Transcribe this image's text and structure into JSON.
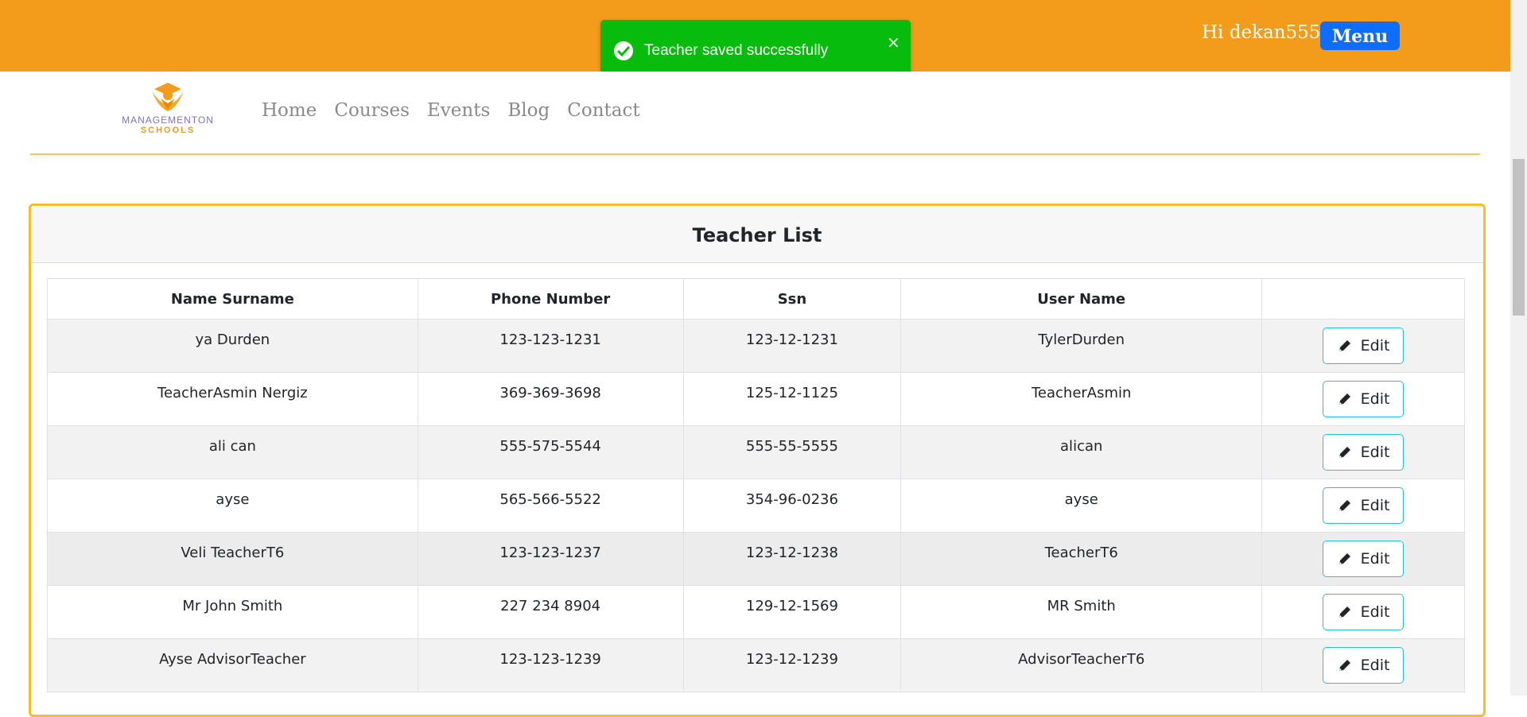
{
  "header": {
    "greeting": "Hi dekan555",
    "menu_label": "Menu"
  },
  "toast": {
    "message": "Teacher saved successfully",
    "close_glyph": "×",
    "color": "#07bc0c"
  },
  "brand": {
    "name_line1": "MANAGEMENTON",
    "name_line2": "SCHOOLS"
  },
  "nav": {
    "items": [
      "Home",
      "Courses",
      "Events",
      "Blog",
      "Contact"
    ]
  },
  "card": {
    "title": "Teacher List"
  },
  "table": {
    "headers": [
      "Name Surname",
      "Phone Number",
      "Ssn",
      "User Name",
      ""
    ],
    "edit_label": "Edit",
    "rows": [
      [
        "ya Durden",
        "123-123-1231",
        "123-12-1231",
        "TylerDurden"
      ],
      [
        "TeacherAsmin Nergiz",
        "369-369-3698",
        "125-12-1125",
        "TeacherAsmin"
      ],
      [
        "ali can",
        "555-575-5544",
        "555-55-5555",
        "alican"
      ],
      [
        "ayse",
        "565-566-5522",
        "354-96-0236",
        "ayse"
      ],
      [
        "Veli TeacherT6",
        "123-123-1237",
        "123-12-1238",
        "TeacherT6"
      ],
      [
        "Mr John Smith",
        "227 234 8904",
        "129-12-1569",
        "MR Smith"
      ],
      [
        "Ayse AdvisorTeacher",
        "123-123-1239",
        "123-12-1239",
        "AdvisorTeacherT6"
      ]
    ]
  },
  "colors": {
    "topbar": "#f39c1b",
    "menu_button": "#0d6efd",
    "card_border": "#f5be2a",
    "edit_border": "#22c1dc"
  },
  "icons": {
    "toast": "check-circle-icon",
    "edit": "pencil-icon"
  }
}
